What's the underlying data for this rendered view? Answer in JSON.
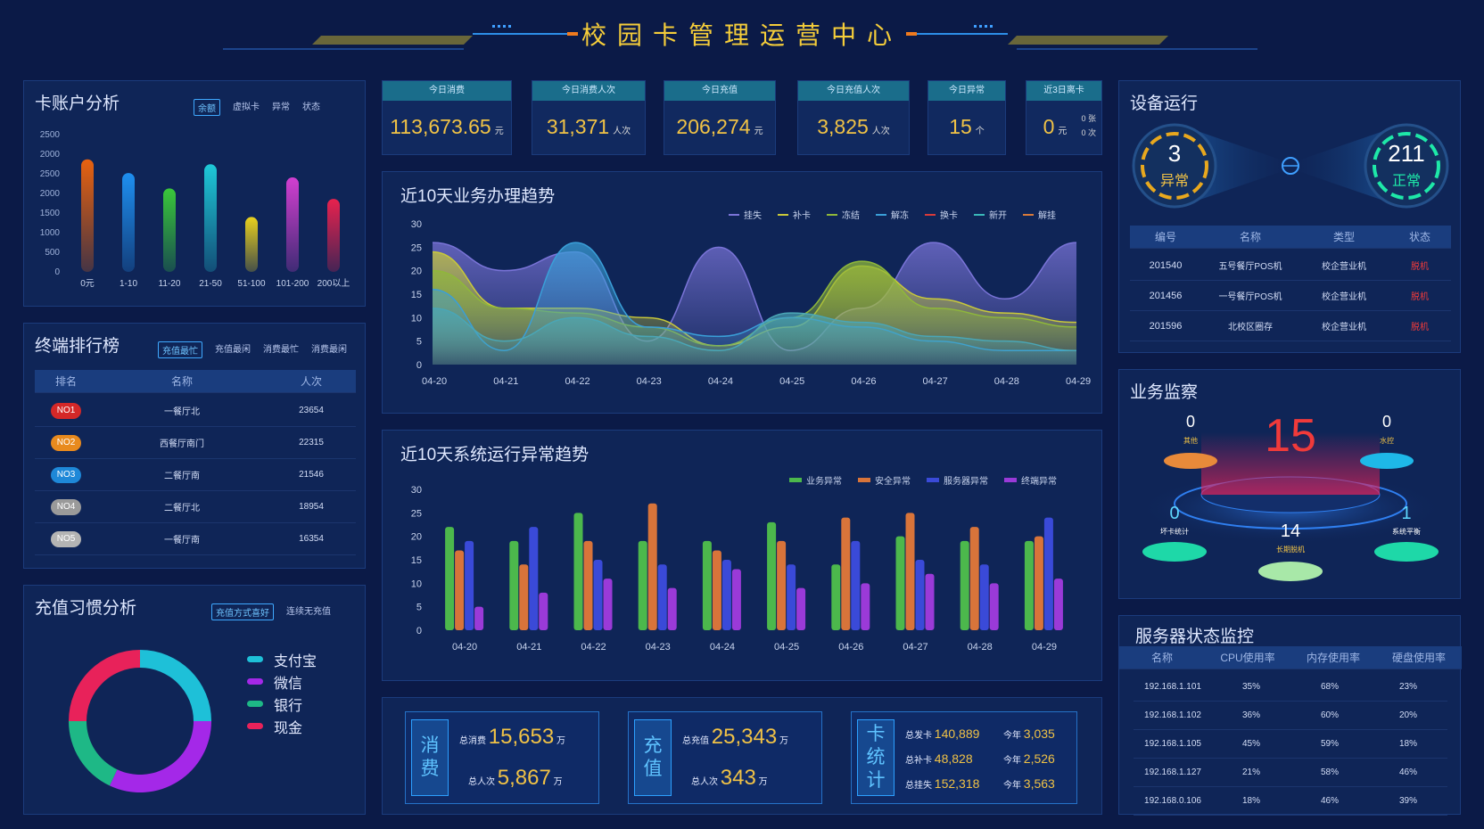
{
  "header": {
    "title": "校园卡管理运营中心"
  },
  "card_analysis": {
    "title": "卡账户分析",
    "tabs": [
      "余额",
      "虚拟卡",
      "异常",
      "状态"
    ],
    "chart_data": {
      "type": "bar",
      "categories": [
        "0元",
        "1-10",
        "11-20",
        "21-50",
        "51-100",
        "101-200",
        "200以上"
      ],
      "values": [
        2050,
        1800,
        1520,
        1960,
        1000,
        1720,
        1330
      ],
      "yticks": [
        "2500",
        "2000",
        "2500",
        "2000",
        "1500",
        "1000",
        "500",
        "0"
      ],
      "ylim": [
        0,
        2500
      ],
      "colors": [
        "#e8620f",
        "#1e8ff0",
        "#3ac83a",
        "#1ec9d8",
        "#e8d01e",
        "#d23fd0",
        "#e8224e"
      ]
    }
  },
  "kpis": [
    {
      "label": "今日消费",
      "value": "113,673.65",
      "unit": "元"
    },
    {
      "label": "今日消费人次",
      "value": "31,371",
      "unit": "人次"
    },
    {
      "label": "今日充值",
      "value": "206,274",
      "unit": "元"
    },
    {
      "label": "今日充值人次",
      "value": "3,825",
      "unit": "人次"
    },
    {
      "label": "今日异常",
      "value": "15",
      "unit": "个"
    },
    {
      "label": "近3日离卡",
      "value": "0",
      "unit": "元",
      "sub1": "0 张",
      "sub2": "0 次"
    }
  ],
  "trend": {
    "title": "近10天业务办理趋势",
    "legend": [
      "挂失",
      "补卡",
      "冻结",
      "解冻",
      "换卡",
      "新开",
      "解挂"
    ],
    "chart_data": {
      "type": "area",
      "x": [
        "04-20",
        "04-21",
        "04-22",
        "04-23",
        "04-24",
        "04-25",
        "04-26",
        "04-27",
        "04-28",
        "04-29"
      ],
      "ylim": [
        0,
        30
      ],
      "yticks": [
        "30",
        "25",
        "20",
        "15",
        "10",
        "5",
        "0"
      ],
      "series": [
        {
          "name": "挂失",
          "color": "#7a74d8",
          "values": [
            26,
            20,
            24,
            5,
            25,
            3,
            12,
            26,
            14,
            26
          ]
        },
        {
          "name": "补卡",
          "color": "#c9c93a",
          "values": [
            24,
            12,
            12,
            10,
            4,
            8,
            21,
            14,
            11,
            9
          ]
        },
        {
          "name": "冻结",
          "color": "#8fb83a",
          "values": [
            20,
            12,
            11,
            8,
            4,
            10,
            22,
            12,
            10,
            8
          ]
        },
        {
          "name": "解冻",
          "color": "#3a9fd8",
          "values": [
            16,
            3,
            26,
            8,
            6,
            10,
            8,
            5,
            3,
            3
          ]
        },
        {
          "name": "新开",
          "color": "#4aa6b6",
          "values": [
            12,
            5,
            10,
            6,
            3,
            11,
            9,
            6,
            5,
            3
          ]
        }
      ]
    }
  },
  "anomaly": {
    "title": "近10天系统运行异常趋势",
    "legend": [
      "业务异常",
      "安全异常",
      "服务器异常",
      "终端异常"
    ],
    "chart_data": {
      "type": "bar",
      "x": [
        "04-20",
        "04-21",
        "04-22",
        "04-23",
        "04-24",
        "04-25",
        "04-26",
        "04-27",
        "04-28",
        "04-29"
      ],
      "ylim": [
        0,
        30
      ],
      "yticks": [
        "30",
        "25",
        "20",
        "15",
        "10",
        "5",
        "0"
      ],
      "series": [
        {
          "name": "业务异常",
          "color": "#4cb84c",
          "values": [
            22,
            19,
            25,
            19,
            19,
            23,
            14,
            20,
            19,
            19
          ]
        },
        {
          "name": "安全异常",
          "color": "#d8743a",
          "values": [
            17,
            14,
            19,
            27,
            17,
            19,
            24,
            25,
            22,
            20
          ]
        },
        {
          "name": "服务器异常",
          "color": "#3a4ad8",
          "values": [
            19,
            22,
            15,
            14,
            15,
            14,
            19,
            15,
            14,
            24
          ]
        },
        {
          "name": "终端异常",
          "color": "#9a3ad8",
          "values": [
            5,
            8,
            11,
            9,
            13,
            9,
            10,
            12,
            10,
            11
          ]
        }
      ]
    }
  },
  "terminal_rank": {
    "title": "终端排行榜",
    "tabs": [
      "充值最忙",
      "充值最闲",
      "消费最忙",
      "消费最闲"
    ],
    "headers": [
      "排名",
      "名称",
      "人次"
    ],
    "rows": [
      {
        "rank": "NO1",
        "name": "一餐厅北",
        "count": "23654",
        "color": "#d42828"
      },
      {
        "rank": "NO2",
        "name": "西餐厅南门",
        "count": "22315",
        "color": "#e88a1e"
      },
      {
        "rank": "NO3",
        "name": "二餐厅南",
        "count": "21546",
        "color": "#1e88d8"
      },
      {
        "rank": "NO4",
        "name": "二餐厅北",
        "count": "18954",
        "color": "#9a9a9a"
      },
      {
        "rank": "NO5",
        "name": "一餐厅南",
        "count": "16354",
        "color": "#b4b4b4"
      }
    ]
  },
  "recharge": {
    "title": "充值习惯分析",
    "tabs": [
      "充值方式喜好",
      "连续无充值"
    ],
    "chart_data": {
      "type": "pie",
      "labels": [
        "支付宝",
        "微信",
        "银行",
        "现金"
      ],
      "values": [
        25,
        32,
        18,
        25
      ],
      "colors": [
        "#1ec0d8",
        "#a428e8",
        "#1eb886",
        "#e8225a"
      ]
    }
  },
  "summary": {
    "consume": {
      "tag": [
        "消",
        "费"
      ],
      "total_label": "总消费",
      "total": "15,653",
      "total_unit": "万",
      "people_label": "总人次",
      "people": "5,867",
      "people_unit": "万"
    },
    "recharge": {
      "tag": [
        "充",
        "值"
      ],
      "total_label": "总充值",
      "total": "25,343",
      "total_unit": "万",
      "people_label": "总人次",
      "people": "343",
      "people_unit": "万"
    },
    "card": {
      "tag": [
        "卡",
        "统",
        "计"
      ],
      "rows": [
        {
          "label": "总发卡",
          "value": "140,889",
          "today_label": "今年",
          "today": "3,035"
        },
        {
          "label": "总补卡",
          "value": "48,828",
          "today_label": "今年",
          "today": "2,526"
        },
        {
          "label": "总挂失",
          "value": "152,318",
          "today_label": "今年",
          "today": "3,563"
        }
      ]
    }
  },
  "device": {
    "title": "设备运行",
    "abnormal": {
      "value": "3",
      "label": "异常"
    },
    "normal": {
      "value": "211",
      "label": "正常"
    },
    "headers": [
      "编号",
      "名称",
      "类型",
      "状态"
    ],
    "rows": [
      {
        "id": "201540",
        "name": "五号餐厅POS机",
        "type": "校企营业机",
        "status": "脱机"
      },
      {
        "id": "201456",
        "name": "一号餐厅POS机",
        "type": "校企营业机",
        "status": "脱机"
      },
      {
        "id": "201596",
        "name": "北校区圈存",
        "type": "校企营业机",
        "status": "脱机"
      }
    ]
  },
  "monitor": {
    "title": "业务监察",
    "center": "15",
    "items": [
      {
        "value": "0",
        "label": "其他"
      },
      {
        "value": "0",
        "label": "水控"
      },
      {
        "value": "0",
        "label": "坏卡统计"
      },
      {
        "value": "14",
        "label": "长期脱机"
      },
      {
        "value": "1",
        "label": "系统平衡"
      }
    ]
  },
  "server": {
    "title": "服务器状态监控",
    "headers": [
      "名称",
      "CPU使用率",
      "内存使用率",
      "硬盘使用率"
    ],
    "rows": [
      [
        "192.168.1.101",
        "35%",
        "68%",
        "23%"
      ],
      [
        "192.168.1.102",
        "36%",
        "60%",
        "20%"
      ],
      [
        "192.168.1.105",
        "45%",
        "59%",
        "18%"
      ],
      [
        "192.168.1.127",
        "21%",
        "58%",
        "46%"
      ],
      [
        "192.168.0.106",
        "18%",
        "46%",
        "39%"
      ]
    ]
  }
}
